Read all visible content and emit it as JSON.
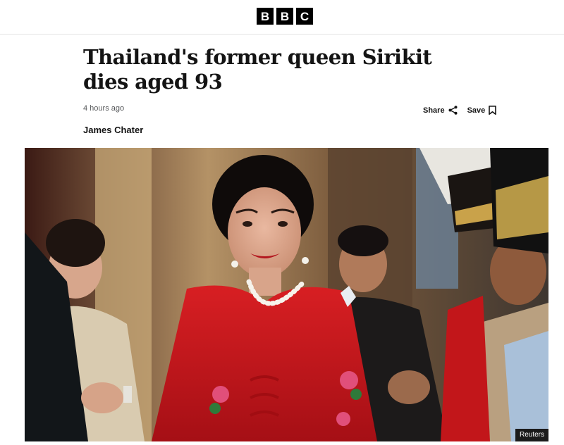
{
  "header": {
    "logo_letters": [
      "B",
      "B",
      "C"
    ]
  },
  "article": {
    "headline": "Thailand's former queen Sirikit dies aged 93",
    "timestamp": "4 hours ago",
    "author": "James Chater",
    "share_label": "Share",
    "save_label": "Save"
  },
  "media": {
    "credit": "Reuters",
    "icons": {
      "share": "share-icon",
      "save": "bookmark-icon"
    }
  },
  "colors": {
    "brand_black": "#000000",
    "text": "#141414",
    "muted": "#545658",
    "dress_red": "#c8161d"
  }
}
